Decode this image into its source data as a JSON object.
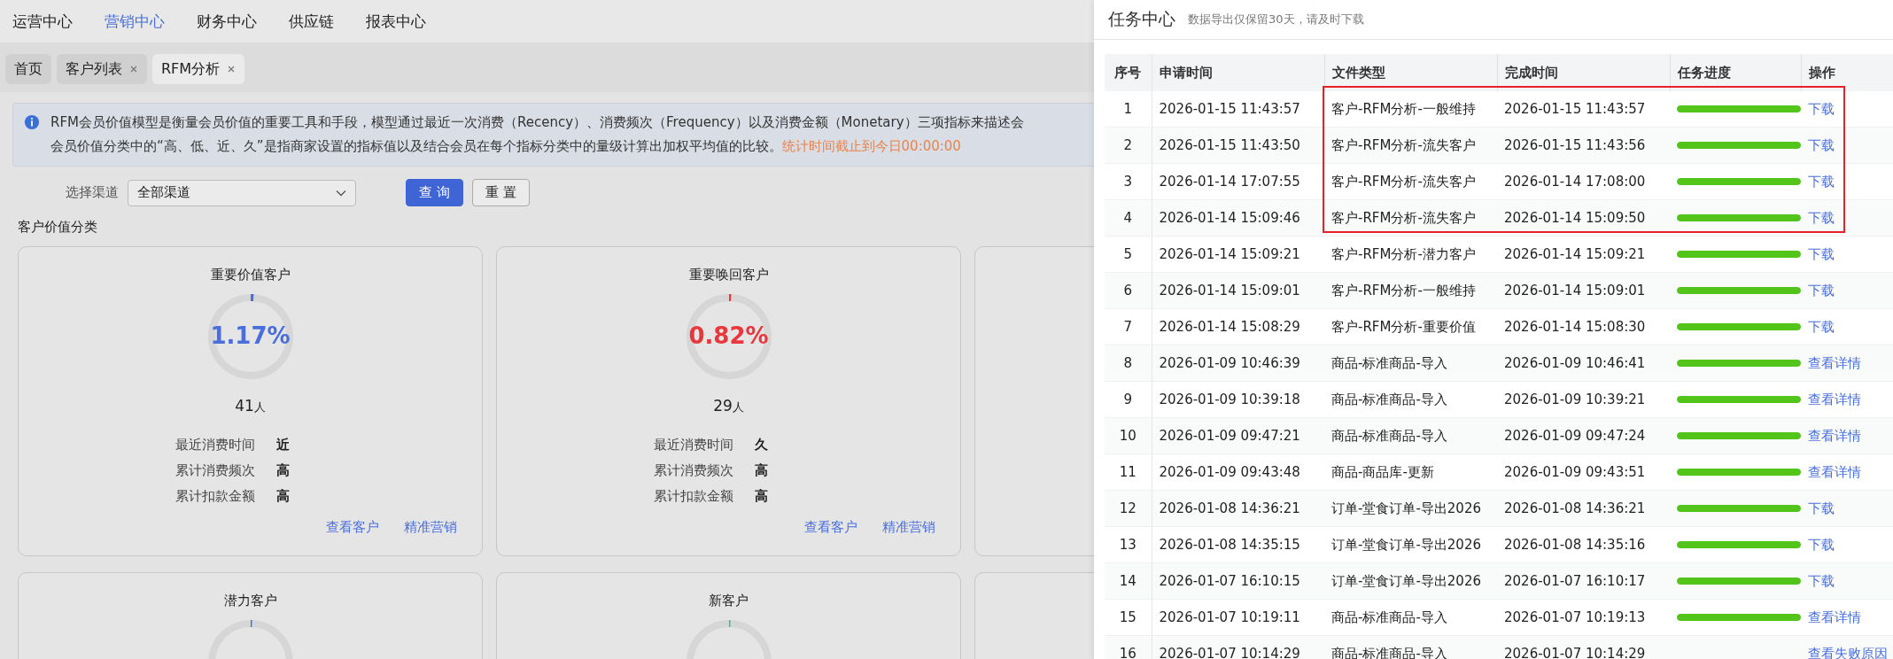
{
  "top_nav": [
    {
      "label": "运营中心",
      "selected": false
    },
    {
      "label": "营销中心",
      "selected": true
    },
    {
      "label": "财务中心",
      "selected": false
    },
    {
      "label": "供应链",
      "selected": false
    },
    {
      "label": "报表中心",
      "selected": false
    }
  ],
  "tabs": [
    {
      "label": "首页",
      "selected": false,
      "closable": false
    },
    {
      "label": "客户列表",
      "selected": false,
      "closable": true
    },
    {
      "label": "RFM分析",
      "selected": true,
      "closable": true
    }
  ],
  "notice": {
    "line_1": "RFM会员价值模型是衡量会员价值的重要工具和手段，模型通过最近一次消费（Recency）、消费频次（Frequency）以及消费金额（Monetary）三项指标来描述会",
    "line_2": "会员价值分类中的“高、低、近、久”是指商家设置的指标值以及结合会员在每个指标分类中的量级计算出加权平均值的比较。",
    "note": "统计时间截止到今日00:00:00"
  },
  "filter": {
    "label": "选择渠道",
    "value": "全部渠道",
    "buttons": [
      {
        "label": "查 询",
        "kind": "primary"
      },
      {
        "label": "重 置",
        "kind": "default"
      }
    ]
  },
  "section_title": "客户价值分类",
  "cards": [
    {
      "kind": "full",
      "title": "重要价值客户",
      "percent": "1.17%",
      "level": 0.0117,
      "color": "#4a6fdc",
      "count": "41",
      "unit": "人",
      "metrics": [
        {
          "label": "最近消费时间",
          "value": "近"
        },
        {
          "label": "累计消费频次",
          "value": "高"
        },
        {
          "label": "累计扣款金额",
          "value": "高"
        }
      ],
      "links": [
        "查看客户",
        "精准营销"
      ]
    },
    {
      "kind": "full",
      "title": "重要唤回客户",
      "percent": "0.82%",
      "level": 0.0082,
      "color": "#e8383d",
      "count": "29",
      "unit": "人",
      "metrics": [
        {
          "label": "最近消费时间",
          "value": "久"
        },
        {
          "label": "累计消费频次",
          "value": "高"
        },
        {
          "label": "累计扣款金额",
          "value": "高"
        }
      ],
      "links": [
        "查看客户",
        "精准营销"
      ]
    },
    {
      "kind": "blank"
    },
    {
      "kind": "partial",
      "title": "潜力客户",
      "level": 0.0023,
      "color": "#4a6fdc"
    },
    {
      "kind": "partial",
      "title": "新客户",
      "level": 0.0048,
      "color": "#2ec08f"
    },
    {
      "kind": "blank"
    }
  ],
  "drawer": {
    "title": "任务中心",
    "subtitle": "数据导出仅保留30天，请及时下载"
  },
  "table": {
    "columns": [
      "序号",
      "申请时间",
      "文件类型",
      "完成时间",
      "任务进度",
      "操作"
    ],
    "rows": [
      {
        "no": "1",
        "requested": "2026-01-15 11:43:57",
        "file_type": "客户-RFM分析-一般维持",
        "completed": "2026-01-15 11:43:57",
        "level": 1,
        "action": "下载",
        "highlighted": true
      },
      {
        "no": "2",
        "requested": "2026-01-15 11:43:50",
        "file_type": "客户-RFM分析-流失客户",
        "completed": "2026-01-15 11:43:56",
        "level": 1,
        "action": "下载",
        "highlighted": true
      },
      {
        "no": "3",
        "requested": "2026-01-14 17:07:55",
        "file_type": "客户-RFM分析-流失客户",
        "completed": "2026-01-14 17:08:00",
        "level": 1,
        "action": "下载",
        "highlighted": true
      },
      {
        "no": "4",
        "requested": "2026-01-14 15:09:46",
        "file_type": "客户-RFM分析-流失客户",
        "completed": "2026-01-14 15:09:50",
        "level": 1,
        "action": "下载",
        "highlighted": true
      },
      {
        "no": "5",
        "requested": "2026-01-14 15:09:21",
        "file_type": "客户-RFM分析-潜力客户",
        "completed": "2026-01-14 15:09:21",
        "level": 1,
        "action": "下载",
        "highlighted": false
      },
      {
        "no": "6",
        "requested": "2026-01-14 15:09:01",
        "file_type": "客户-RFM分析-一般维持",
        "completed": "2026-01-14 15:09:01",
        "level": 1,
        "action": "下载",
        "highlighted": false
      },
      {
        "no": "7",
        "requested": "2026-01-14 15:08:29",
        "file_type": "客户-RFM分析-重要价值",
        "completed": "2026-01-14 15:08:30",
        "level": 1,
        "action": "下载",
        "highlighted": false
      },
      {
        "no": "8",
        "requested": "2026-01-09 10:46:39",
        "file_type": "商品-标准商品-导入",
        "completed": "2026-01-09 10:46:41",
        "level": 1,
        "action": "查看详情",
        "highlighted": false
      },
      {
        "no": "9",
        "requested": "2026-01-09 10:39:18",
        "file_type": "商品-标准商品-导入",
        "completed": "2026-01-09 10:39:21",
        "level": 1,
        "action": "查看详情",
        "highlighted": false
      },
      {
        "no": "10",
        "requested": "2026-01-09 09:47:21",
        "file_type": "商品-标准商品-导入",
        "completed": "2026-01-09 09:47:24",
        "level": 1,
        "action": "查看详情",
        "highlighted": false
      },
      {
        "no": "11",
        "requested": "2026-01-09 09:43:48",
        "file_type": "商品-商品库-更新",
        "completed": "2026-01-09 09:43:51",
        "level": 1,
        "action": "查看详情",
        "highlighted": false
      },
      {
        "no": "12",
        "requested": "2026-01-08 14:36:21",
        "file_type": "订单-堂食订单-导出2026",
        "completed": "2026-01-08 14:36:21",
        "level": 1,
        "action": "下载",
        "highlighted": false
      },
      {
        "no": "13",
        "requested": "2026-01-08 14:35:15",
        "file_type": "订单-堂食订单-导出2026",
        "completed": "2026-01-08 14:35:16",
        "level": 1,
        "action": "下载",
        "highlighted": false
      },
      {
        "no": "14",
        "requested": "2026-01-07 16:10:15",
        "file_type": "订单-堂食订单-导出2026",
        "completed": "2026-01-07 16:10:17",
        "level": 1,
        "action": "下载",
        "highlighted": false
      },
      {
        "no": "15",
        "requested": "2026-01-07 10:19:11",
        "file_type": "商品-标准商品-导入",
        "completed": "2026-01-07 10:19:13",
        "level": 1,
        "action": "查看详情",
        "highlighted": false
      },
      {
        "no": "16",
        "requested": "2026-01-07 10:14:29",
        "file_type": "商品-标准商品-导入",
        "completed": "2026-01-07 10:14:29",
        "action": "查看失败原因",
        "highlighted": false
      }
    ]
  }
}
